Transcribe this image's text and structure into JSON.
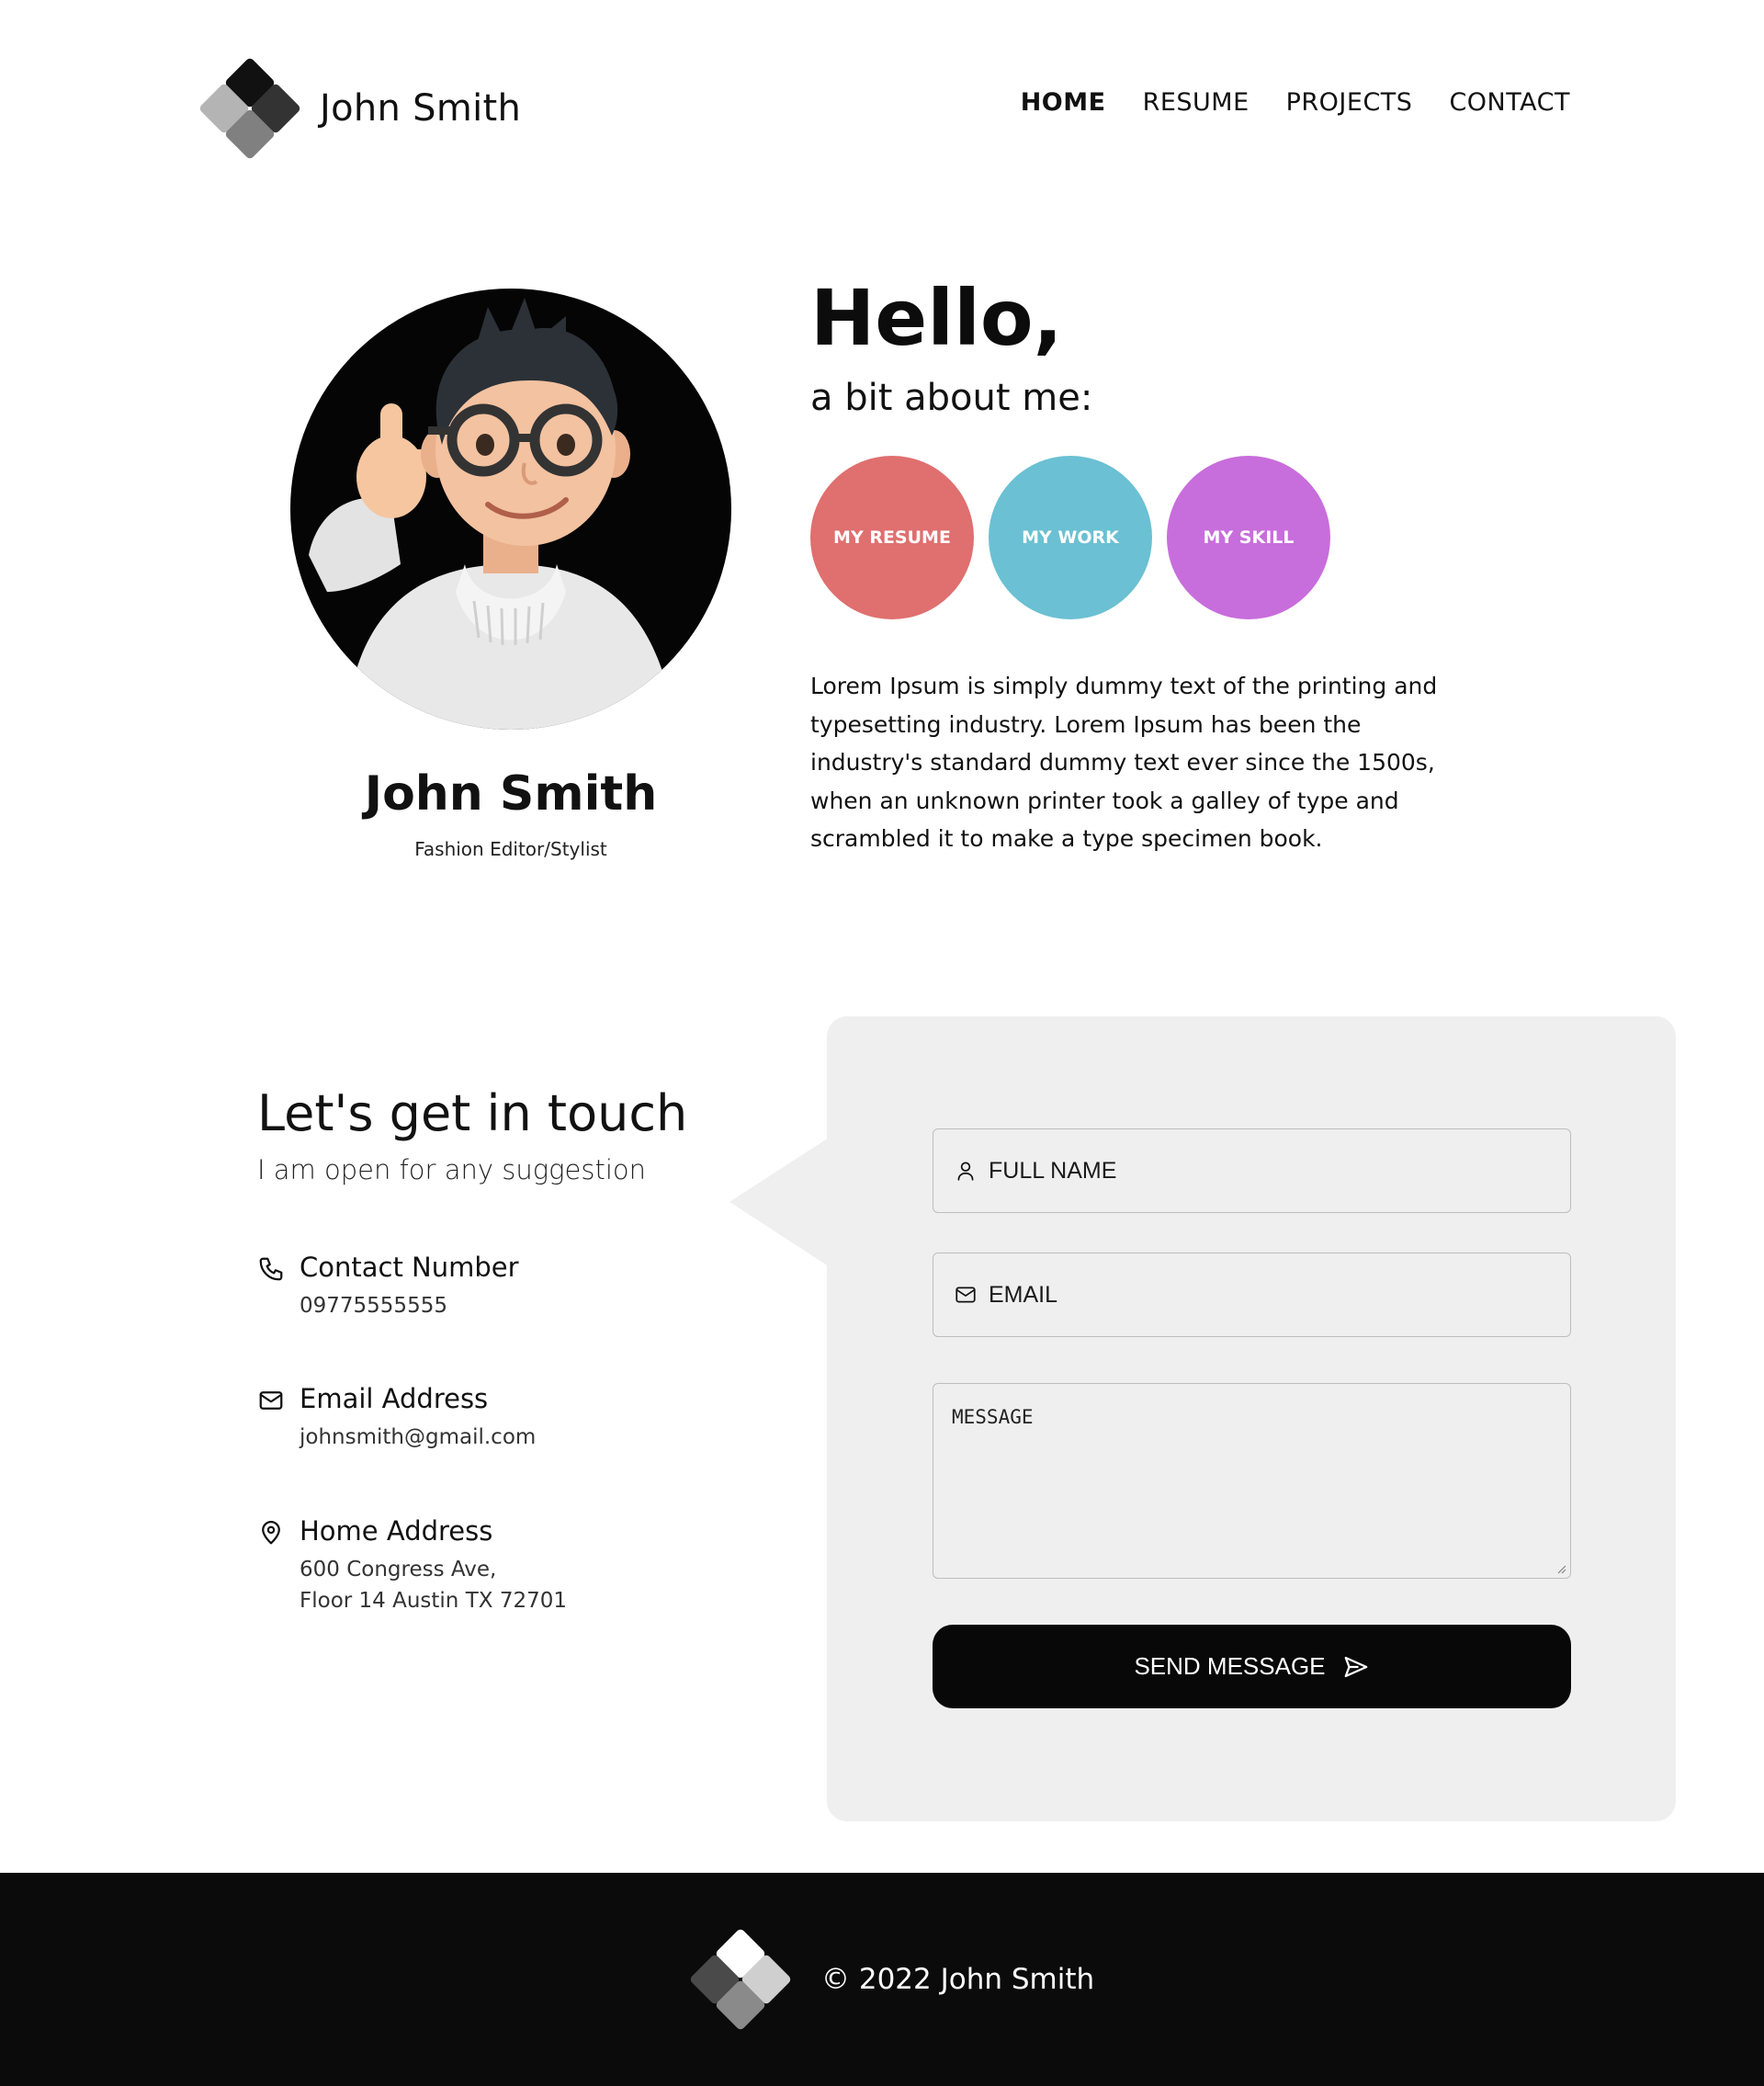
{
  "brand": {
    "name": "John Smith",
    "logo_icon": "diamond-cluster-logo-icon"
  },
  "nav": {
    "items": [
      {
        "label": "HOME",
        "active": true
      },
      {
        "label": "RESUME",
        "active": false
      },
      {
        "label": "PROJECTS",
        "active": false
      },
      {
        "label": "CONTACT",
        "active": false
      }
    ]
  },
  "profile": {
    "name": "John Smith",
    "role": "Fashion Editor/Stylist",
    "avatar_icon": "memoji-avatar"
  },
  "hero": {
    "greeting": "Hello,",
    "subtitle": "a bit about me:",
    "buttons": [
      {
        "label": "MY RESUME",
        "color": "#e06f6f"
      },
      {
        "label": "MY WORK",
        "color": "#6bc0d3"
      },
      {
        "label": "MY SKILL",
        "color": "#c86ddc"
      }
    ],
    "bio": "Lorem Ipsum is simply dummy text of the printing and typesetting industry. Lorem Ipsum has been the industry's standard dummy text ever since the 1500s, when an unknown printer took a galley of type and scrambled it to make a type specimen book."
  },
  "contact": {
    "title": "Let's get in touch",
    "subtitle": "I am open for any suggestion",
    "items": [
      {
        "icon": "phone-icon",
        "label": "Contact Number",
        "lines": [
          "09775555555"
        ]
      },
      {
        "icon": "mail-icon",
        "label": "Email Address",
        "lines": [
          "johnsmith@gmail.com"
        ]
      },
      {
        "icon": "location-pin-icon",
        "label": "Home Address",
        "lines": [
          "600 Congress Ave,",
          "Floor 14 Austin TX 72701"
        ]
      }
    ]
  },
  "form": {
    "name_placeholder": "FULL NAME",
    "email_placeholder": "EMAIL",
    "message_placeholder": "MESSAGE",
    "send_label": "SEND MESSAGE",
    "send_icon": "send-icon"
  },
  "footer": {
    "copyright": "© 2022 John Smith"
  },
  "colors": {
    "dark": "#0b0b0b",
    "panel": "#efefef",
    "resume": "#e06f6f",
    "work": "#6bc0d3",
    "skill": "#c86ddc"
  }
}
